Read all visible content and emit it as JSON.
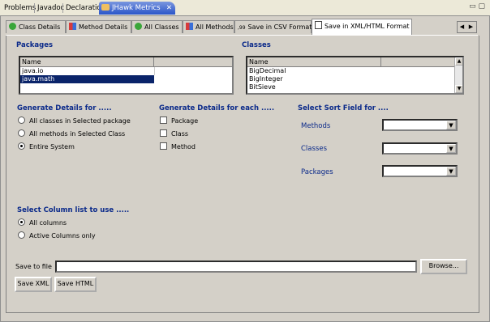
{
  "view_tabs": [
    {
      "label": "Problems",
      "active": false
    },
    {
      "label": "Javadoc",
      "active": false
    },
    {
      "label": "Declaration",
      "active": false
    },
    {
      "label": "JHawk Metrics",
      "active": true
    }
  ],
  "close_glyph": "✕",
  "window_controls": "▭ ▢",
  "inner_tabs": [
    {
      "label": "Class Details",
      "icon": "green-circle-icon"
    },
    {
      "label": "Method Details",
      "icon": "red-blue-icon"
    },
    {
      "label": "All Classes",
      "icon": "green-circle-icon"
    },
    {
      "label": "All Methods",
      "icon": "red-blue-icon"
    },
    {
      "label": "Save in CSV Format",
      "icon": "csv-icon"
    },
    {
      "label": "Save in XML/HTML Format",
      "icon": "document-icon"
    }
  ],
  "tab_scroll": {
    "left": "◀",
    "right": "▶"
  },
  "packages": {
    "title": "Packages",
    "column": "Name",
    "items": [
      "java.io",
      "java.math"
    ],
    "selected_index": 1
  },
  "classes": {
    "title": "Classes",
    "column": "Name",
    "items": [
      "BigDecimal",
      "BigInteger",
      "BitSieve"
    ]
  },
  "generate_details_for": {
    "title": "Generate Details for .....",
    "options": [
      "All classes in Selected package",
      "All methods in Selected Class",
      "Entire System"
    ],
    "selected_index": 2
  },
  "generate_details_each": {
    "title": "Generate Details for each .....",
    "options": [
      "Package",
      "Class",
      "Method"
    ]
  },
  "sort_field": {
    "title": "Select Sort Field for ....",
    "labels": [
      "Methods",
      "Classes",
      "Packages"
    ]
  },
  "column_list": {
    "title": "Select Column list to use .....",
    "options": [
      "All columns",
      "Active Columns only"
    ],
    "selected_index": 0
  },
  "save": {
    "label": "Save to file",
    "value": "",
    "browse": "Browse...",
    "save_xml": "Save XML",
    "save_html": "Save HTML"
  },
  "colors": {
    "accent": "#0b2a8a",
    "selection": "#0a246a",
    "face": "#d4d0c8"
  }
}
